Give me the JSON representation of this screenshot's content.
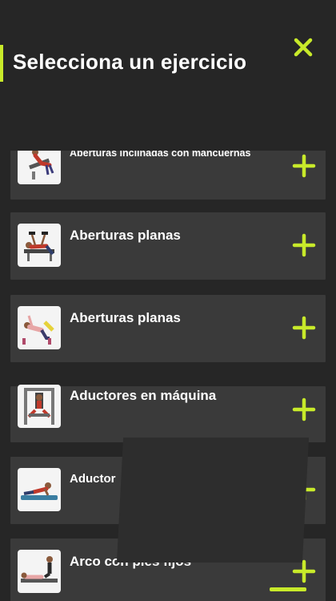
{
  "header": {
    "title": "Selecciona un ejercicio",
    "close_icon": "close-x-icon"
  },
  "accent_color": "#c8ea2a",
  "exercises": [
    {
      "label": "Aberturas inclinadas con mancuernas",
      "thumbnail": "inclined-dumbbell-fly-icon",
      "add_icon": "plus-icon"
    },
    {
      "label": "Aberturas planas",
      "thumbnail": "flat-bench-fly-icon",
      "add_icon": "plus-icon"
    },
    {
      "label": "Aberturas planas",
      "thumbnail": "flat-fly-band-icon",
      "add_icon": "plus-icon"
    },
    {
      "label": "Aductores en máquina",
      "thumbnail": "adductor-machine-icon",
      "add_icon": "plus-icon"
    },
    {
      "label": "Aductor",
      "thumbnail": "adductor-floor-icon",
      "add_icon": "plus-icon"
    },
    {
      "label": "Arco con pies fijos",
      "thumbnail": "arch-feet-fixed-icon",
      "add_icon": "plus-icon"
    }
  ]
}
